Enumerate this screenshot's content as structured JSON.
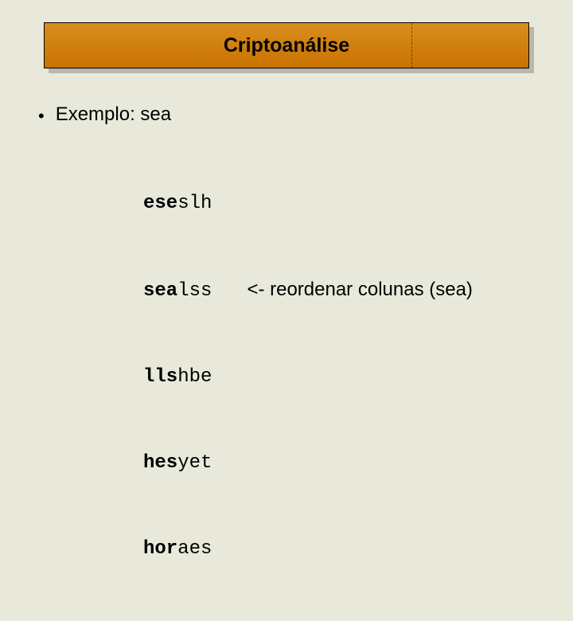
{
  "title": "Criptoanálise",
  "bullet": {
    "dot": "•",
    "label_prefix": "Exemplo: ",
    "keyword": "sea"
  },
  "rows": [
    {
      "key": "ese",
      "rest": "slh",
      "note": ""
    },
    {
      "key": "sea",
      "rest": "lss",
      "note": "<- reordenar colunas (sea)"
    },
    {
      "key": "lls",
      "rest": "hbe",
      "note": ""
    },
    {
      "key": "hes",
      "rest": "yet",
      "note": ""
    },
    {
      "key": "hor",
      "rest": "aes",
      "note": ""
    }
  ]
}
